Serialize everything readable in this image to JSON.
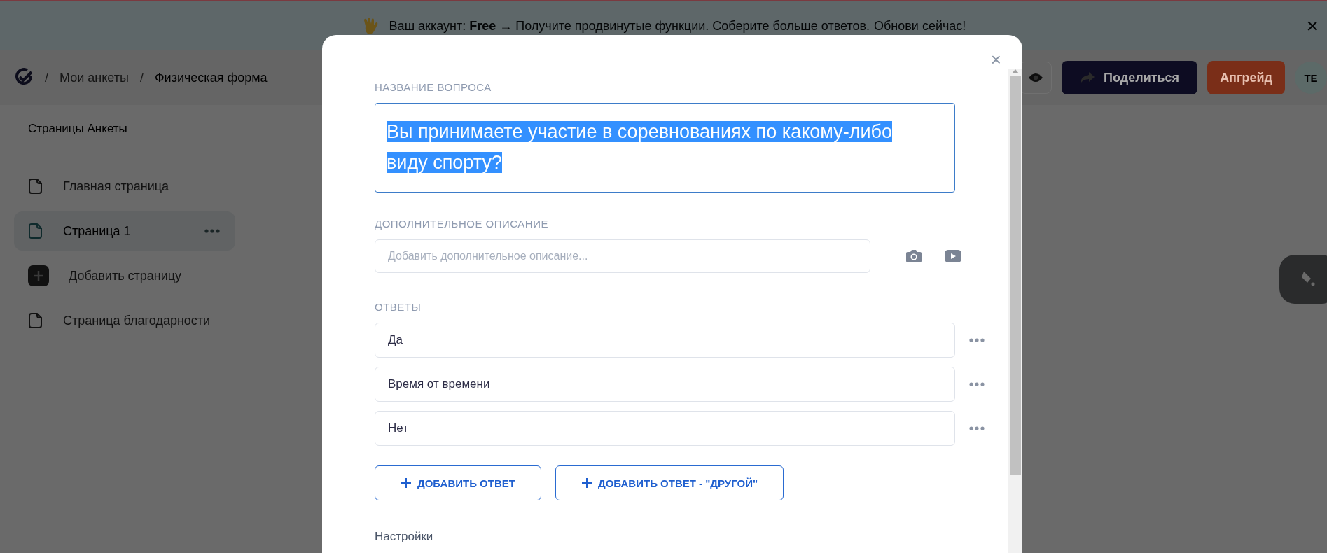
{
  "banner": {
    "text": "Ваш аккаунт: **Free** → Получите продвинутые функции. Соберите больше ответов.",
    "link": "Обнови сейчас!",
    "close": "×"
  },
  "header": {
    "breadcrumbs": [
      "Мои анкеты",
      "Физическая форма"
    ],
    "separator": "/",
    "share_button": "Поделиться",
    "upgrade_button": "Апгрейд",
    "avatar": "TE"
  },
  "sidebar": {
    "title": "Страницы Анкеты",
    "items": [
      {
        "label": "Главная страница",
        "kind": "page",
        "selected": false
      },
      {
        "label": "Страница 1",
        "kind": "page",
        "selected": true
      },
      {
        "label": "Добавить страницу",
        "kind": "add",
        "selected": false
      },
      {
        "label": "Страница благодарности",
        "kind": "page",
        "selected": false
      }
    ]
  },
  "modal": {
    "close": "×",
    "question_label": "НАЗВАНИЕ ВОПРОСА",
    "question": {
      "value": "Вы принимаете участие в соревнованиях по какому-либо виду спорту?",
      "text_selected": true
    },
    "description_label": "ДОПОЛНИТЕЛЬНОЕ ОПИСАНИЕ",
    "description": {
      "placeholder": "Добавить дополнительное описание..."
    },
    "answers_label": "ОТВЕТЫ",
    "answers": [
      "Да",
      "Время от времени",
      "Нет"
    ],
    "buttons": [
      "ДОБАВИТЬ ОТВЕТ",
      "ДОБАВИТЬ ОТВЕТ - \"ДРУГОЙ\""
    ],
    "settings_label": "Настройки"
  }
}
